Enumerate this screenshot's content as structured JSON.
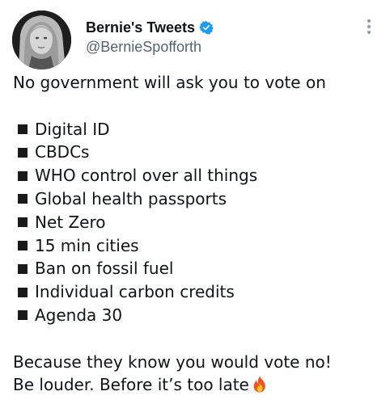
{
  "author": {
    "display_name": "Bernie's Tweets",
    "handle": "@BernieSpofforth",
    "verified_color": "#1d9bf0"
  },
  "tweet": {
    "intro": "No government will ask you to vote on",
    "items": [
      "Digital ID",
      "CBDCs",
      "WHO control over all things",
      "Global health passports",
      "Net Zero",
      "15 min cities",
      "Ban on fossil fuel",
      "Individual carbon credits",
      "Agenda 30"
    ],
    "closing_1": "Because they know you would vote no!",
    "closing_2": "Be louder. Before it’s too late",
    "bullet_icon": "black-square-icon",
    "emoji_icon": "fire-icon"
  },
  "icons": {
    "more": "more-options-icon",
    "verified": "verified-badge-icon"
  }
}
